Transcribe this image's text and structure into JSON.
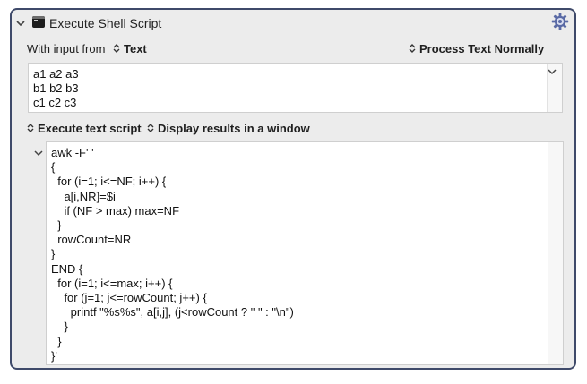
{
  "action": {
    "title": "Execute Shell Script",
    "icons": {
      "collapse": "chevron-down-icon",
      "action": "terminal-icon",
      "settings": "gear-icon"
    }
  },
  "input": {
    "label": "With input from",
    "source": "Text",
    "processing": "Process Text Normally",
    "text_lines": [
      "a1 a2 a3",
      "b1 b2 b3",
      "c1 c2 c3"
    ]
  },
  "execution": {
    "mode": "Execute text script",
    "results": "Display results in a window"
  },
  "script": "awk -F' '\n{\n  for (i=1; i<=NF; i++) {\n    a[i,NR]=$i\n    if (NF > max) max=NF\n  }\n  rowCount=NR\n}\nEND {\n  for (i=1; i<=max; i++) {\n    for (j=1; j<=rowCount; j++) {\n      printf \"%s%s\", a[i,j], (j<rowCount ? \" \" : \"\\n\")\n    }\n  }\n}'",
  "colors": {
    "panel_border": "#3f4a6a",
    "panel_bg": "#ececec",
    "gear": "#5a6aa5"
  }
}
